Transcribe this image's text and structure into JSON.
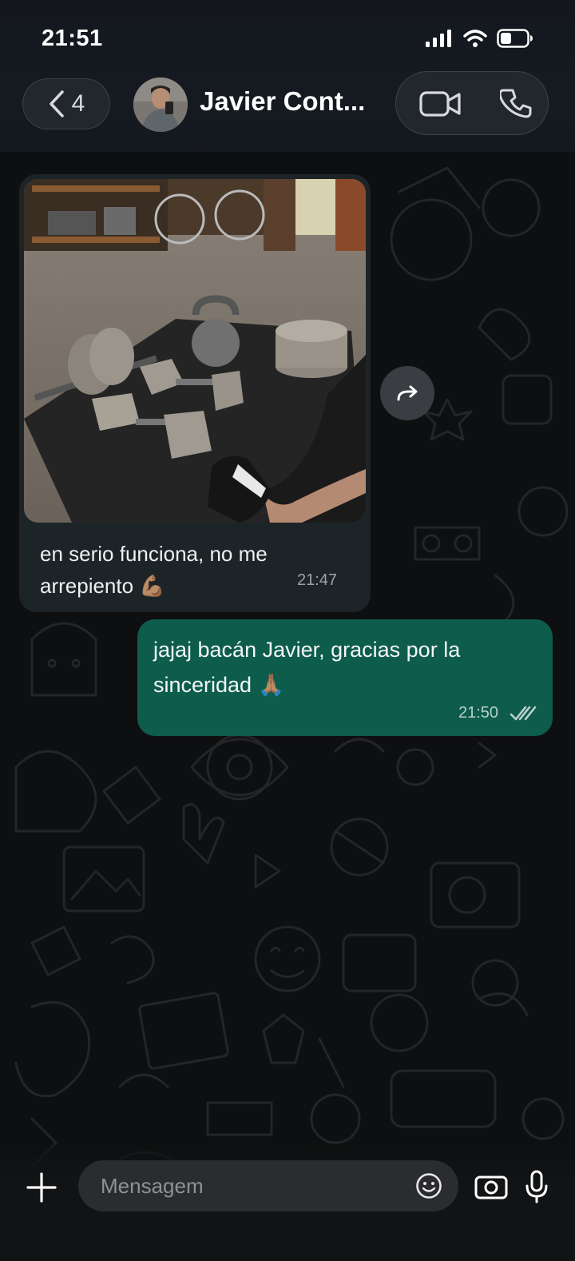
{
  "status_bar": {
    "time": "21:51"
  },
  "header": {
    "back_count": "4",
    "contact_name": "Javier Cont..."
  },
  "messages": [
    {
      "direction": "incoming",
      "has_photo": true,
      "text_line1": "en serio funciona, no me",
      "text_line2": "arrepiento 💪🏽",
      "time": "21:47"
    },
    {
      "direction": "outgoing",
      "text_line1": "jajaj bacán Javier, gracias por la",
      "text_line2": "sinceridad 🙏🏽",
      "time": "21:50",
      "status": "read"
    }
  ],
  "composer": {
    "placeholder": "Mensagem"
  },
  "colors": {
    "incoming_bubble": "#1d2427",
    "outgoing_bubble": "#0d5c4c",
    "background": "#0e0f10"
  },
  "icons": [
    "signal-icon",
    "wifi-icon",
    "battery-icon",
    "chevron-left-icon",
    "video-call-icon",
    "phone-icon",
    "forward-icon",
    "double-check-icon",
    "plus-icon",
    "sticker-icon",
    "camera-icon",
    "mic-icon"
  ]
}
